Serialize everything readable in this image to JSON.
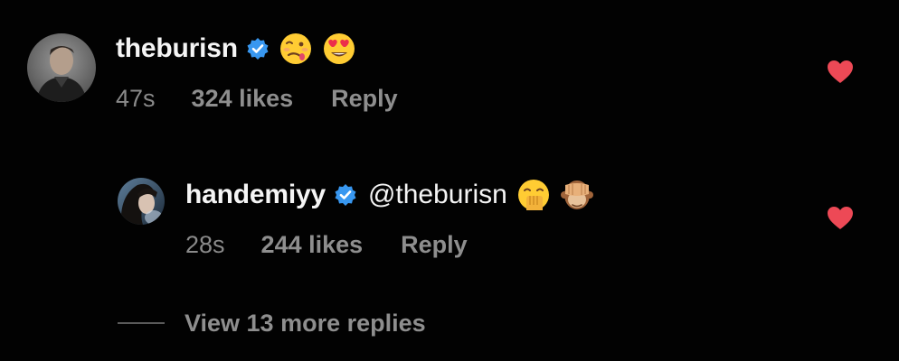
{
  "comments": [
    {
      "username": "theburisn",
      "verified": true,
      "mention": "",
      "emojis": [
        "woozy-face-emoji",
        "heart-eyes-emoji"
      ],
      "time": "47s",
      "likes": "324 likes",
      "reply_label": "Reply",
      "liked": true
    },
    {
      "username": "handemiyy",
      "verified": true,
      "mention": "@theburisn",
      "emojis": [
        "hand-over-mouth-emoji",
        "see-no-evil-monkey-emoji"
      ],
      "time": "28s",
      "likes": "244 likes",
      "reply_label": "Reply",
      "liked": true
    }
  ],
  "view_more_replies": "View 13 more replies",
  "colors": {
    "background": "#000000",
    "primary_text": "#f5f5f5",
    "secondary_text": "#8e8e8e",
    "verified_blue": "#3897f0",
    "like_red": "#ed4956"
  }
}
